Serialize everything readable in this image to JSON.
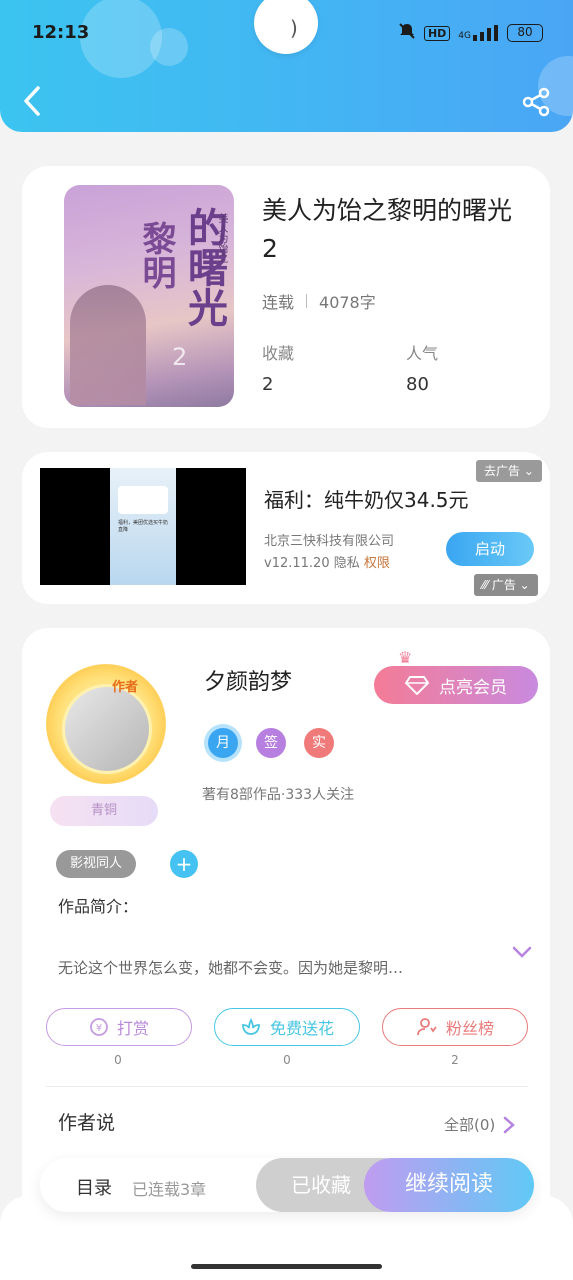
{
  "status_bar": {
    "time": "12:13",
    "network": "HD",
    "signal": "4G",
    "battery": "80"
  },
  "book": {
    "cover_title": "的曙光",
    "cover_title_2": "黎明",
    "cover_subtitle": "美人为饴之",
    "cover_number": "2",
    "title": "美人为饴之黎明的曙光2",
    "status": "连载",
    "word_count": "4078字",
    "stats": [
      {
        "label": "收藏",
        "value": "2"
      },
      {
        "label": "人气",
        "value": "80"
      }
    ]
  },
  "ad": {
    "title": "福利：纯牛奶仅34.5元",
    "company": "北京三快科技有限公司",
    "version": "v12.11.20",
    "privacy": "隐私",
    "permission": "权限",
    "start_label": "启动",
    "close_label": "去广告",
    "tag_label": "广告",
    "phone_text": "福利，美团优选买牛奶直降"
  },
  "author": {
    "badge": "作者",
    "rank": "青铜",
    "name": "夕颜韵梦",
    "vip_label": "点亮会员",
    "badges": [
      {
        "label": "月",
        "color": "#3aa6f1"
      },
      {
        "label": "签",
        "color": "#b77fe0"
      },
      {
        "label": "实",
        "color": "#f07a7a"
      }
    ],
    "info": "著有8部作品·333人关注"
  },
  "genre_tag": "影视同人",
  "intro": {
    "label": "作品简介：",
    "text": "无论这个世界怎么变，她都不会变。因为她是黎明…"
  },
  "actions": [
    {
      "label": "打赏",
      "count": "0",
      "color": "#b98ad8"
    },
    {
      "label": "免费送花",
      "count": "0",
      "color": "#48c6e2"
    },
    {
      "label": "粉丝榜",
      "count": "2",
      "color": "#ea7b7b"
    }
  ],
  "author_says": {
    "label": "作者说",
    "link": "全部(0)"
  },
  "bottom": {
    "toc_label": "目录",
    "toc_status": "已连载3章",
    "fav_label": "已收藏",
    "read_label": "继续阅读"
  },
  "colors": {
    "accent": "#43b5f3",
    "vip": "#f47c96"
  }
}
